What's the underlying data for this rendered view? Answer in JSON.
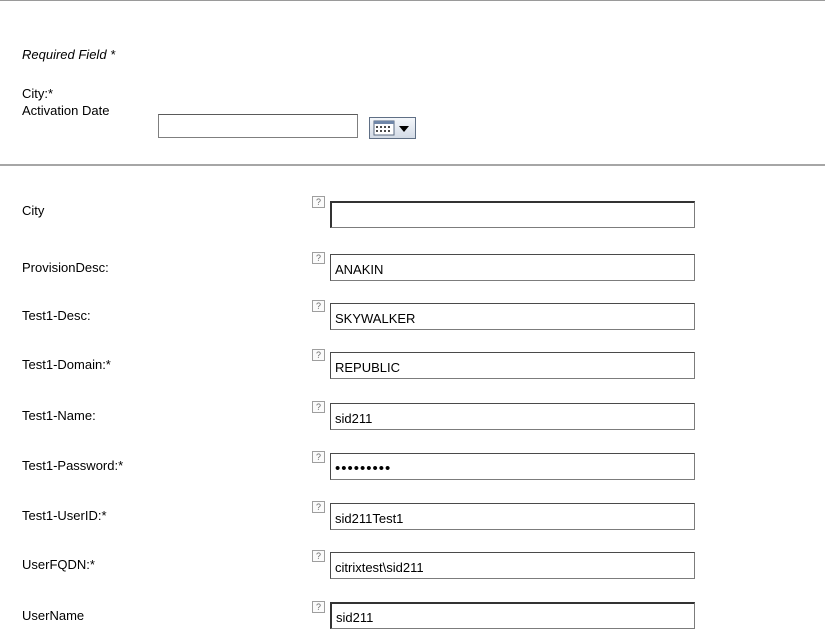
{
  "header": {
    "required_note": "Required Field *",
    "city_label": "City:*",
    "activation_date_label": "Activation Date",
    "activation_date_value": ""
  },
  "icons": {
    "calendar": "calendar-dropdown-icon",
    "help": "help-question-icon"
  },
  "help_glyph": "?",
  "form": {
    "rows": [
      {
        "label": "City",
        "value": ""
      },
      {
        "label": "ProvisionDesc:",
        "value": "ANAKIN"
      },
      {
        "label": "Test1-Desc:",
        "value": "SKYWALKER"
      },
      {
        "label": "Test1-Domain:*",
        "value": "REPUBLIC"
      },
      {
        "label": "Test1-Name:",
        "value": "sid211"
      },
      {
        "label": "Test1-Password:*",
        "value": "•••••••••"
      },
      {
        "label": "Test1-UserID:*",
        "value": "sid211Test1"
      },
      {
        "label": "UserFQDN:*",
        "value": "citrixtest\\sid211"
      },
      {
        "label": "UserName",
        "value": "sid211"
      }
    ]
  }
}
